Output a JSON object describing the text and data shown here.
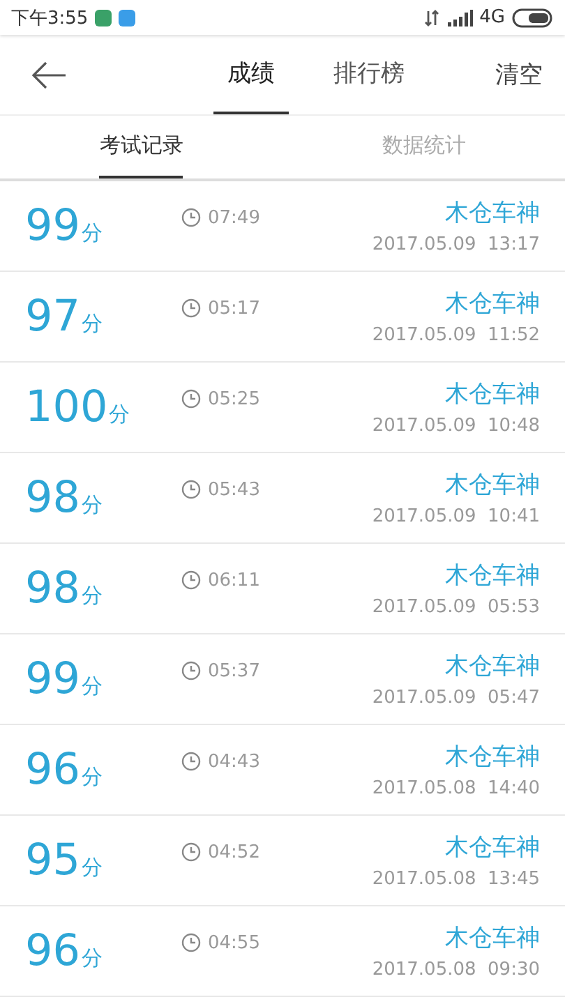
{
  "status_bar": {
    "time": "下午3:55",
    "network": "4G"
  },
  "header": {
    "tabs": [
      {
        "label": "成绩",
        "selected": true
      },
      {
        "label": "排行榜",
        "selected": false
      }
    ],
    "action": "清空"
  },
  "subtabs": [
    {
      "label": "考试记录",
      "selected": true
    },
    {
      "label": "数据统计",
      "selected": false
    }
  ],
  "records": [
    {
      "score": "99",
      "unit": "分",
      "duration": "07:49",
      "name": "木仓车神",
      "date": "2017.05.09",
      "time": "13:17"
    },
    {
      "score": "97",
      "unit": "分",
      "duration": "05:17",
      "name": "木仓车神",
      "date": "2017.05.09",
      "time": "11:52"
    },
    {
      "score": "100",
      "unit": "分",
      "duration": "05:25",
      "name": "木仓车神",
      "date": "2017.05.09",
      "time": "10:48"
    },
    {
      "score": "98",
      "unit": "分",
      "duration": "05:43",
      "name": "木仓车神",
      "date": "2017.05.09",
      "time": "10:41"
    },
    {
      "score": "98",
      "unit": "分",
      "duration": "06:11",
      "name": "木仓车神",
      "date": "2017.05.09",
      "time": "05:53"
    },
    {
      "score": "99",
      "unit": "分",
      "duration": "05:37",
      "name": "木仓车神",
      "date": "2017.05.09",
      "time": "05:47"
    },
    {
      "score": "96",
      "unit": "分",
      "duration": "04:43",
      "name": "木仓车神",
      "date": "2017.05.08",
      "time": "14:40"
    },
    {
      "score": "95",
      "unit": "分",
      "duration": "04:52",
      "name": "木仓车神",
      "date": "2017.05.08",
      "time": "13:45"
    },
    {
      "score": "96",
      "unit": "分",
      "duration": "04:55",
      "name": "木仓车神",
      "date": "2017.05.08",
      "time": "09:30"
    }
  ]
}
